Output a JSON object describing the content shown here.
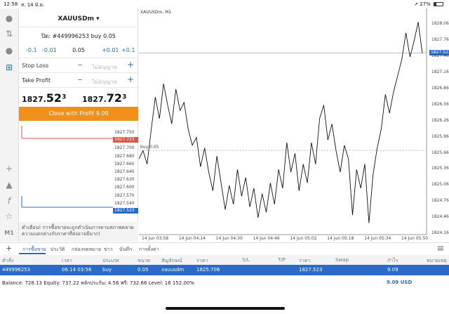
{
  "status": {
    "time": "12:58",
    "date": "ส. 14 มิ.ย.",
    "battery": "27%"
  },
  "order": {
    "symbol": "XAUUSDm",
    "info": "ปิด: #449996253 buy 0.05",
    "vol_minus_1": "-0.1",
    "vol_minus_01": "-0.01",
    "volume": "0.05",
    "vol_plus_01": "+0.01",
    "vol_plus_1": "+0.1",
    "stop_loss_label": "Stop Loss",
    "take_profit_label": "Take Profit",
    "not_allowed": "ไม่อนุญาต",
    "bid_prefix": "1827.",
    "bid_large": "52",
    "bid_sup": "3",
    "ask_prefix": "1827.",
    "ask_large": "72",
    "ask_sup": "3",
    "close_button": "Close with Profit 9.09",
    "mini_ticks": [
      "1827.750",
      "1827.723",
      "1827.700",
      "1827.680",
      "1827.660",
      "1827.640",
      "1827.630",
      "1827.600",
      "1827.570",
      "1827.540",
      "1827.523"
    ],
    "warning": "คำเตือน! การซื้อขายจะถูกดำเนินการตามสภาพตลาด ความแตกต่างกับราคาที่ส่งอาจมีมาก!"
  },
  "chart": {
    "title": "XAUUSDm, M1",
    "buy_label": "buy 0.05",
    "current_price_tag": "1827.523",
    "y_ticks": [
      "1828.060",
      "1827.760",
      "1827.523",
      "1827.460",
      "1827.160",
      "1826.860",
      "1826.560",
      "1826.260",
      "1825.960",
      "1825.660",
      "1825.360",
      "1825.060",
      "1824.760",
      "1824.460",
      "1824.160"
    ],
    "x_ticks": [
      "14 Jun 03:58",
      "14 Jun 04:14",
      "14 Jun 04:30",
      "14 Jun 04:46",
      "14 Jun 05:02",
      "14 Jun 05:18",
      "14 Jun 05:34",
      "14 Jun 05:50"
    ]
  },
  "chart_data": {
    "type": "line",
    "title": "XAUUSDm, M1",
    "xlabel": "",
    "ylabel": "",
    "ylim": [
      1824.16,
      1828.25
    ],
    "x": [
      "03:58",
      "04:14",
      "04:30",
      "04:46",
      "05:02",
      "05:18",
      "05:34",
      "05:50"
    ],
    "series": [
      {
        "values": [
          1825.55,
          1825.7,
          1825.45,
          1826.1,
          1826.7,
          1826.3,
          1826.95,
          1826.55,
          1826.2,
          1826.85,
          1826.45,
          1826.6,
          1826.1,
          1825.8,
          1825.95,
          1825.4,
          1825.75,
          1825.3,
          1824.95,
          1825.6,
          1825.1,
          1824.6,
          1825.05,
          1824.7,
          1825.35,
          1824.85,
          1825.2,
          1824.65,
          1825.0,
          1824.45,
          1824.9,
          1824.55,
          1825.1,
          1824.7,
          1825.35,
          1825.0,
          1825.85,
          1825.3,
          1825.65,
          1824.95,
          1825.45,
          1825.1,
          1825.85,
          1825.45,
          1826.3,
          1826.55,
          1825.9,
          1826.2,
          1825.7,
          1825.3,
          1825.8,
          1825.55,
          1824.5,
          1825.35,
          1825.0,
          1825.45,
          1824.35,
          1825.25,
          1825.75,
          1826.1,
          1826.75,
          1826.4,
          1826.8,
          1827.1,
          1827.4,
          1827.9,
          1827.45,
          1827.75,
          1828.1,
          1827.52
        ]
      }
    ],
    "grid": false,
    "horizontal_lines": [
      {
        "label": "buy 0.05",
        "value": 1825.706
      },
      {
        "label": "current",
        "value": 1827.523
      }
    ]
  },
  "tabs": [
    "การซื้อขาย",
    "ประวัติ",
    "กล่องจดหมาย",
    "ข่าว",
    "บันทึก",
    "การตั้งค่า"
  ],
  "table": {
    "headers": [
      "คำสั่ง",
      "เวลา",
      "ประเภท",
      "ขนาด",
      "สัญลักษณ์",
      "ราคา",
      "S/L",
      "T/P",
      "ราคา",
      "Swap",
      "กำไร",
      "หมายเหตุ"
    ],
    "row": [
      "449996253",
      "06.14 03:56",
      "buy",
      "0.05",
      "xauusdm",
      "1825.706",
      "",
      "",
      "1827.523",
      "",
      "9.09",
      ""
    ]
  },
  "balance": {
    "text": "Balance: 728.13 Equity: 737.22 พลักประกัน: 4.56 ฟรี: 732.66 Level: 16 152.00%",
    "profit": "9.09",
    "currency": "USD"
  },
  "colors": {
    "accent": "#2a6ac9",
    "close_button": "#f0901a",
    "sell_tag": "#e0554a"
  }
}
